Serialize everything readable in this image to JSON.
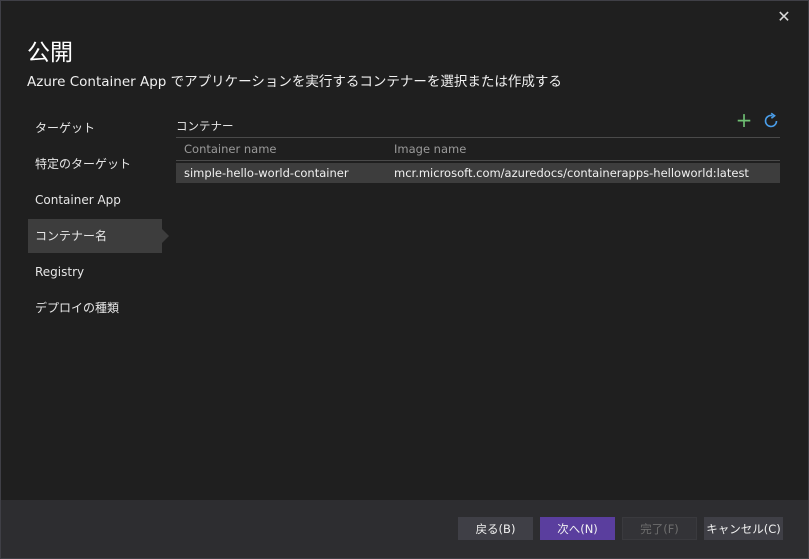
{
  "dialog": {
    "close_glyph": "✕",
    "title": "公開",
    "subtitle": "Azure Container App でアプリケーションを実行するコンテナーを選択または作成する"
  },
  "sidebar": {
    "items": [
      {
        "label": "ターゲット",
        "active": false
      },
      {
        "label": "特定のターゲット",
        "active": false
      },
      {
        "label": "Container App",
        "active": false
      },
      {
        "label": "コンテナー名",
        "active": true
      },
      {
        "label": "Registry",
        "active": false
      },
      {
        "label": "デプロイの種類",
        "active": false
      }
    ]
  },
  "panel": {
    "label": "コンテナー",
    "add_glyph": "+",
    "add_color": "#6fbf73",
    "refresh_color": "#4a9eea",
    "columns": [
      "Container name",
      "Image name"
    ],
    "rows": [
      [
        "simple-hello-world-container",
        "mcr.microsoft.com/azuredocs/containerapps-helloworld:latest"
      ]
    ]
  },
  "footer": {
    "back_label": "戻る(B)",
    "next_label": "次へ(N)",
    "finish_label": "完了(F)",
    "cancel_label": "キャンセル(C)",
    "accent": "#5a3e9e"
  }
}
